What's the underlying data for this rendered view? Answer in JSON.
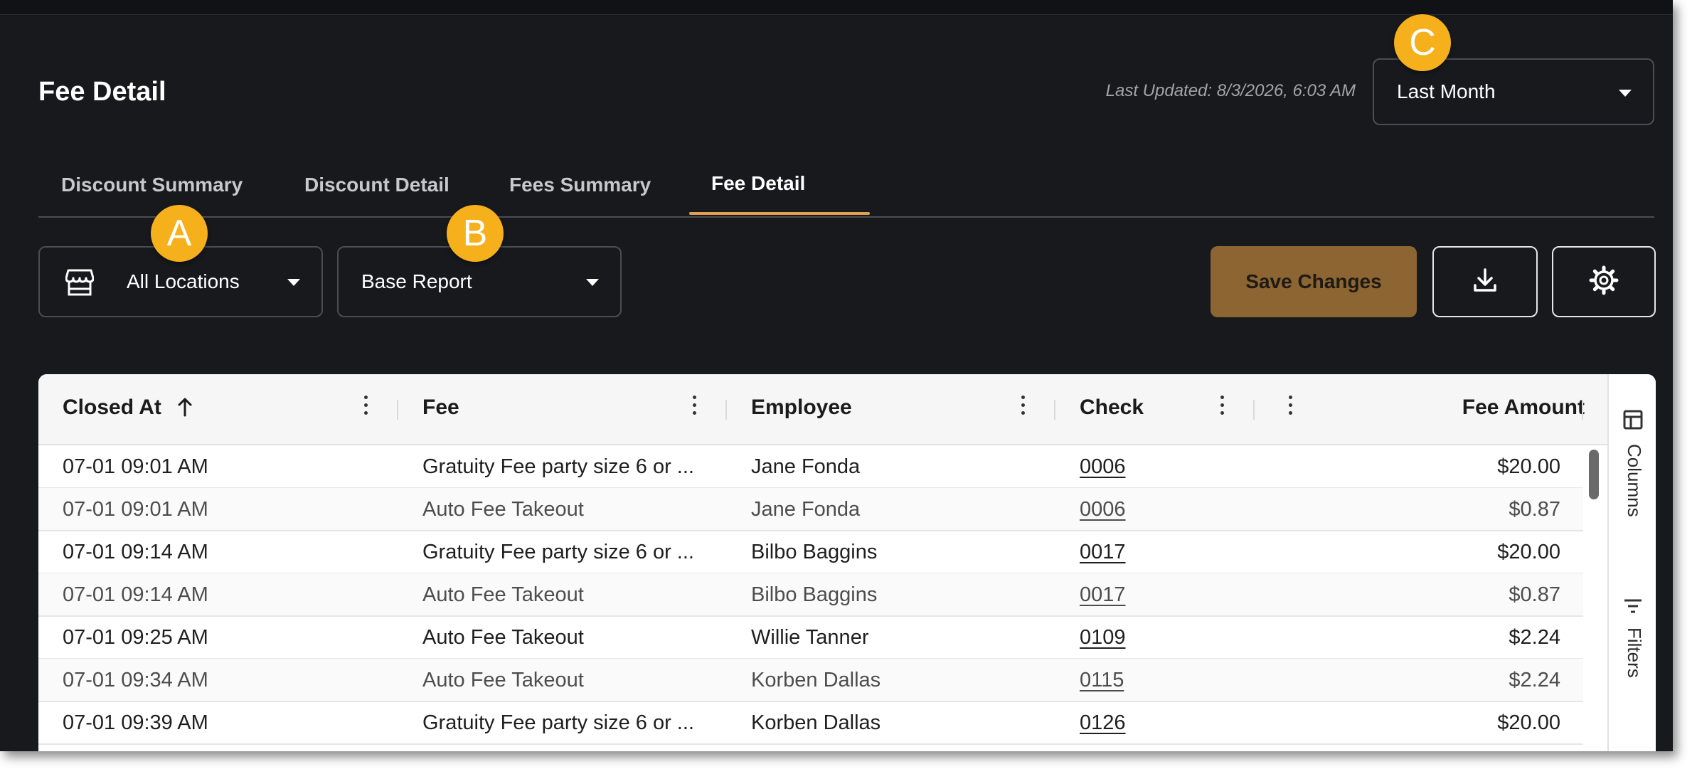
{
  "header": {
    "title": "Fee Detail",
    "last_updated": "Last Updated: 8/3/2026, 6:03 AM",
    "period_selected": "Last Month"
  },
  "tabs": [
    {
      "label": "Discount Summary",
      "active": false
    },
    {
      "label": "Discount Detail",
      "active": false
    },
    {
      "label": "Fees Summary",
      "active": false
    },
    {
      "label": "Fee Detail",
      "active": true
    }
  ],
  "toolbar": {
    "location_selected": "All Locations",
    "report_selected": "Base Report",
    "save_label": "Save Changes",
    "location_icon": "store-icon",
    "download_icon": "download-icon",
    "settings_icon": "gear-icon"
  },
  "markers": [
    "A",
    "B",
    "C"
  ],
  "table": {
    "columns": [
      {
        "label": "Closed At",
        "sort": "ascending"
      },
      {
        "label": "Fee"
      },
      {
        "label": "Employee"
      },
      {
        "label": "Check"
      },
      {
        "label": ""
      },
      {
        "label": "Fee Amount"
      }
    ],
    "rows": [
      {
        "closed_at": "07-01 09:01 AM",
        "fee": "Gratuity Fee party size 6 or ...",
        "employee": "Jane Fonda",
        "check": "0006",
        "amount": "$20.00"
      },
      {
        "closed_at": "07-01 09:01 AM",
        "fee": "Auto Fee Takeout",
        "employee": "Jane Fonda",
        "check": "0006",
        "amount": "$0.87"
      },
      {
        "closed_at": "07-01 09:14 AM",
        "fee": "Gratuity Fee party size 6 or ...",
        "employee": "Bilbo Baggins",
        "check": "0017",
        "amount": "$20.00"
      },
      {
        "closed_at": "07-01 09:14 AM",
        "fee": "Auto Fee Takeout",
        "employee": "Bilbo Baggins",
        "check": "0017",
        "amount": "$0.87"
      },
      {
        "closed_at": "07-01 09:25 AM",
        "fee": "Auto Fee Takeout",
        "employee": "Willie Tanner",
        "check": "0109",
        "amount": "$2.24"
      },
      {
        "closed_at": "07-01 09:34 AM",
        "fee": "Auto Fee Takeout",
        "employee": "Korben Dallas",
        "check": "0115",
        "amount": "$2.24"
      },
      {
        "closed_at": "07-01 09:39 AM",
        "fee": "Gratuity Fee party size 6 or ...",
        "employee": "Korben Dallas",
        "check": "0126",
        "amount": "$20.00"
      }
    ]
  },
  "side_panel": {
    "columns_label": "Columns",
    "filters_label": "Filters"
  },
  "colors": {
    "background": "#17191d",
    "accent": "#e0a050",
    "save_button": "#8c6532",
    "marker": "#f5b01c"
  }
}
